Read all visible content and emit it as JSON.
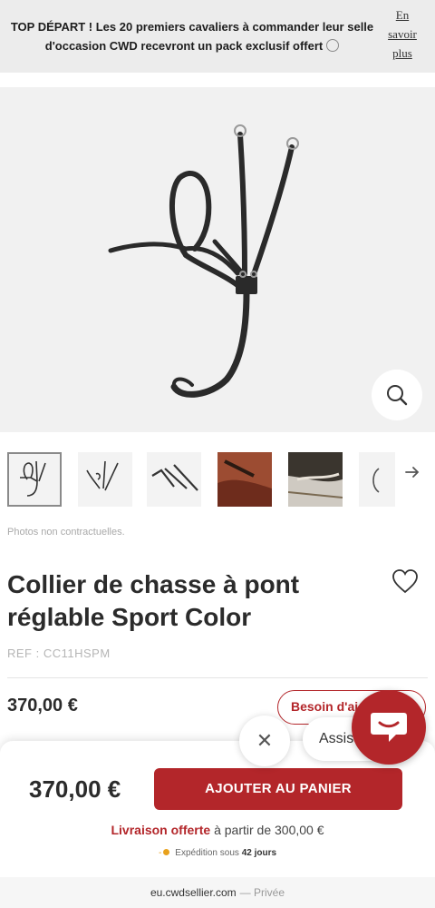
{
  "promo": {
    "text": "TOP DÉPART ! Les 20 premiers cavaliers à commander leur selle d'occasion CWD recevront un pack exclusif offert",
    "link": "En savoir plus"
  },
  "gallery": {
    "note": "Photos non contractuelles."
  },
  "product": {
    "title": "Collier de chasse à pont réglable Sport Color",
    "ref": "REF : CC11HSPM",
    "price": "370,00 €",
    "help_label": "Besoin d'aide"
  },
  "chat": {
    "close": "✕",
    "bubble_label": "Assistance"
  },
  "sticky": {
    "price": "370,00 €",
    "add_to_cart": "AJOUTER AU PANIER",
    "delivery_highlight": "Livraison offerte",
    "delivery_rest": "à partir de 300,00 €",
    "shipping_label": "Expédition sous",
    "shipping_days": "42 jours"
  },
  "browser": {
    "domain": "eu.cwdsellier.com",
    "mode": "— Privée"
  },
  "colors": {
    "brand_red": "#b3262a",
    "shipping_dot": "#e8a11c"
  }
}
